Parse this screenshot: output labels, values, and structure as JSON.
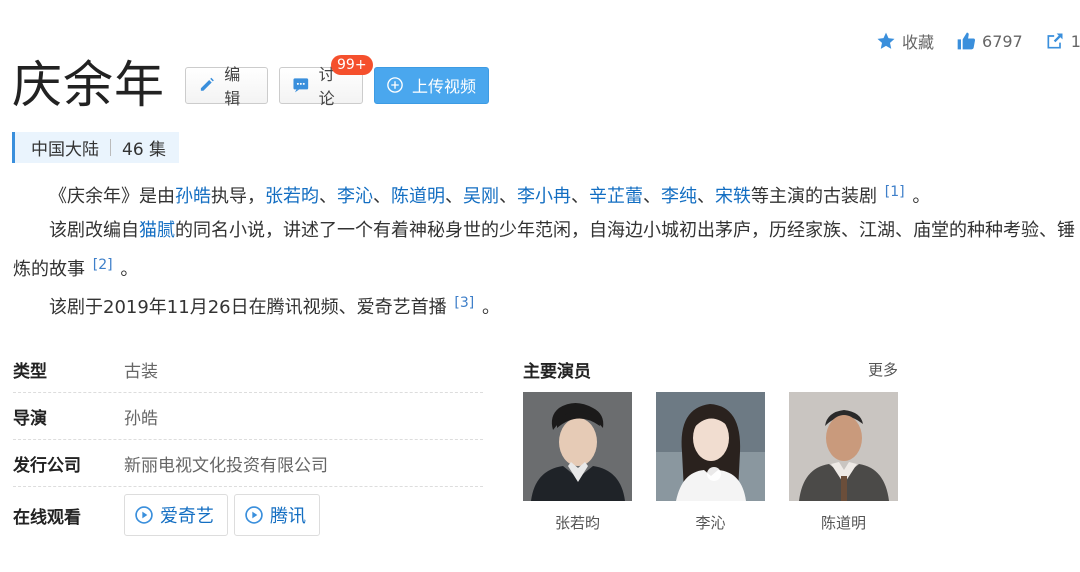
{
  "actions": {
    "favorite_label": "收藏",
    "like_count": "6797",
    "share_count": "1"
  },
  "title": "庆余年",
  "buttons": {
    "edit": "编辑",
    "discuss": "讨论",
    "discuss_badge": "99+",
    "upload": "上传视频"
  },
  "meta": {
    "region": "中国大陆",
    "episodes": "46 集"
  },
  "intro": {
    "p1_prefix": "《庆余年》是由",
    "director": "孙皓",
    "p1_mid": "执导，",
    "cast_links": [
      "张若昀",
      "李沁",
      "陈道明",
      "吴刚",
      "李小冉",
      "辛芷蕾",
      "李纯",
      "宋轶"
    ],
    "separator": "、",
    "p1_suffix": "等主演的古装剧",
    "ref1": "[1]",
    "p1_end": "。",
    "p2_prefix": "该剧改编自",
    "author": "猫腻",
    "p2_text": "的同名小说，讲述了一个有着神秘身世的少年范闲，自海边小城初出茅庐，历经家族、江湖、庙堂的种种考验、锤炼的故事",
    "ref2": "[2]",
    "p2_end": "。",
    "p3_text": "该剧于2019年11月26日在腾讯视频、爱奇艺首播",
    "ref3": "[3]",
    "p3_end": "。"
  },
  "info": {
    "genre_key": "类型",
    "genre_val": "古装",
    "director_key": "导演",
    "director_val": "孙皓",
    "company_key": "发行公司",
    "company_val": "新丽电视文化投资有限公司",
    "watch_key": "在线观看",
    "watch_iqiyi": "爱奇艺",
    "watch_tencent": "腾讯"
  },
  "cast": {
    "title": "主要演员",
    "more": "更多",
    "actors": [
      {
        "name": "张若昀"
      },
      {
        "name": "李沁"
      },
      {
        "name": "陈道明"
      }
    ]
  },
  "colors": {
    "link": "#136ec2",
    "accent": "#4aa7ee",
    "badge": "#f5502d"
  }
}
